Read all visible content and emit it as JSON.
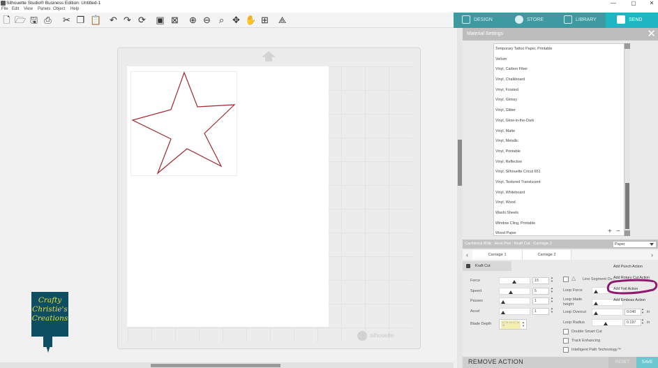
{
  "titlebar": {
    "title": "Silhouette Studio® Business Edition: Untitled-1",
    "minimize": "—",
    "maximize": "▢",
    "close": "✕"
  },
  "menu": [
    "File",
    "Edit",
    "View",
    "Panels",
    "Object",
    "Help"
  ],
  "toolbar": {
    "icons": [
      "new-document-icon",
      "open-folder-icon",
      "save-icon",
      "print-icon",
      "cut-icon",
      "copy-icon",
      "paste-icon",
      "undo-icon",
      "redo-icon",
      "redraw-icon",
      "group-icon",
      "ungroup-icon",
      "zoom-in-icon",
      "zoom-out-icon",
      "zoom-select-icon",
      "move-icon",
      "pan-hand-icon",
      "fit-to-page-icon",
      "pattern-fill-icon"
    ]
  },
  "tabs": [
    {
      "label": "DESIGN",
      "active": false
    },
    {
      "label": "STORE",
      "active": false
    },
    {
      "label": "LIBRARY",
      "active": false
    },
    {
      "label": "SEND",
      "active": true
    }
  ],
  "canvas": {
    "mat_logo": "silhouette",
    "star_color": "#a0282c"
  },
  "watermark": {
    "line1": "Crafty",
    "line2": "Christie's",
    "line3": "Creations",
    "bg": "#0d4e63",
    "fg": "#e7df34"
  },
  "material_panel": {
    "title": "Material Settings",
    "materials": [
      "Temporary Tattoo Paper, Printable",
      "Vellum",
      "Vinyl, Carbon Fiber",
      "Vinyl, Chalkboard",
      "Vinyl, Frosted",
      "Vinyl, Glossy",
      "Vinyl, Glitter",
      "Vinyl, Glow-in-the-Dark",
      "Vinyl, Matte",
      "Vinyl, Metallic",
      "Vinyl, Printable",
      "Vinyl, Reflective",
      "Vinyl, Silhouette Cricut 651",
      "Vinyl, Textured Translucent",
      "Vinyl, Whiteboard",
      "Vinyl, Wood",
      "Washi Sheets",
      "Window Cling, Printable",
      "Wood Paper"
    ],
    "add_label": "+",
    "remove_label": "−"
  },
  "cut_settings": {
    "summary": "Cardstock 80lb : Heat Pen : Kraft Cut : Carriage 2",
    "paper_dropdown": "Paper",
    "carriage_prev": "‹",
    "carriage_next": "›",
    "carriage1": "Carriage 1",
    "carriage2": "Carriage 2",
    "action_label": "Kraft Cut",
    "force_label": "Force",
    "force_value": "15",
    "speed_label": "Speed",
    "speed_value": "5",
    "passes_label": "Passes",
    "passes_value": "1",
    "accel_label": "Accel",
    "accel_value": "1",
    "blade_depth_label": "Blade Depth",
    "blade_depth_text": "12 24 16 12 14 18",
    "line_segment_label": "Line Segment Ov...",
    "loop_force_label": "Loop Force",
    "loop_blade_height_label": "Loop blade height",
    "loop_overcut_label": "Loop Overcut",
    "loop_overcut_value": "0.040",
    "loop_overcut_unit": "in",
    "loop_radius_label": "Loop Radius",
    "loop_radius_value": "0.197",
    "loop_radius_unit": "in",
    "double_smart_cut_label": "Double Smart Cut",
    "track_enhancing_label": "Track Enhancing",
    "intelligent_path_label": "Intelligent Path Technology™",
    "add_actions": [
      "Add Punch Action",
      "Add Rotary Cut Action",
      "Add Foil Action",
      "Add Emboss Action"
    ],
    "highlight_color": "#8d1a6f"
  },
  "footer": {
    "remove_action": "REMOVE ACTION",
    "reset": "RESET",
    "save": "SAVE"
  }
}
